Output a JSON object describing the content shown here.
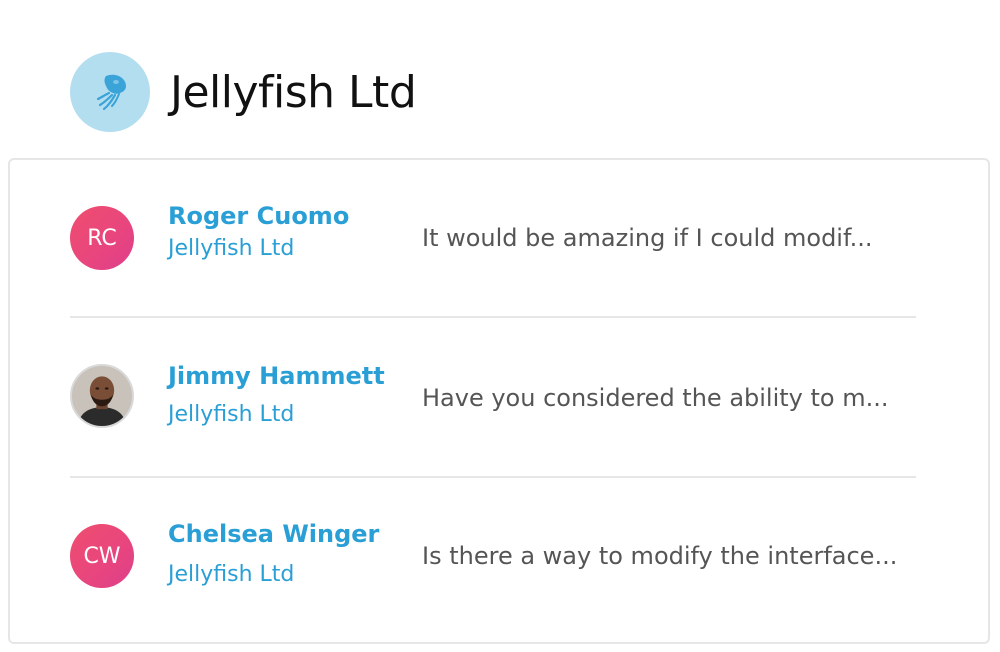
{
  "company": {
    "name": "Jellyfish Ltd",
    "logo_icon": "jellyfish-icon",
    "logo_bg": "#b3def0"
  },
  "messages": [
    {
      "initials": "RC",
      "avatar_type": "initials",
      "name": "Roger Cuomo",
      "company": "Jellyfish Ltd",
      "preview": "It would be amazing if I could modif..."
    },
    {
      "initials": "",
      "avatar_type": "photo",
      "name": "Jimmy Hammett",
      "company": "Jellyfish Ltd",
      "preview": "Have you considered the ability to m..."
    },
    {
      "initials": "CW",
      "avatar_type": "initials",
      "name": "Chelsea Winger",
      "company": "Jellyfish Ltd",
      "preview": "Is there a way to modify the interface..."
    }
  ],
  "colors": {
    "accent": "#2a9fd6",
    "avatar_gradient_start": "#ef4e6e",
    "avatar_gradient_end": "#dd3f8a",
    "text_muted": "#555555"
  }
}
